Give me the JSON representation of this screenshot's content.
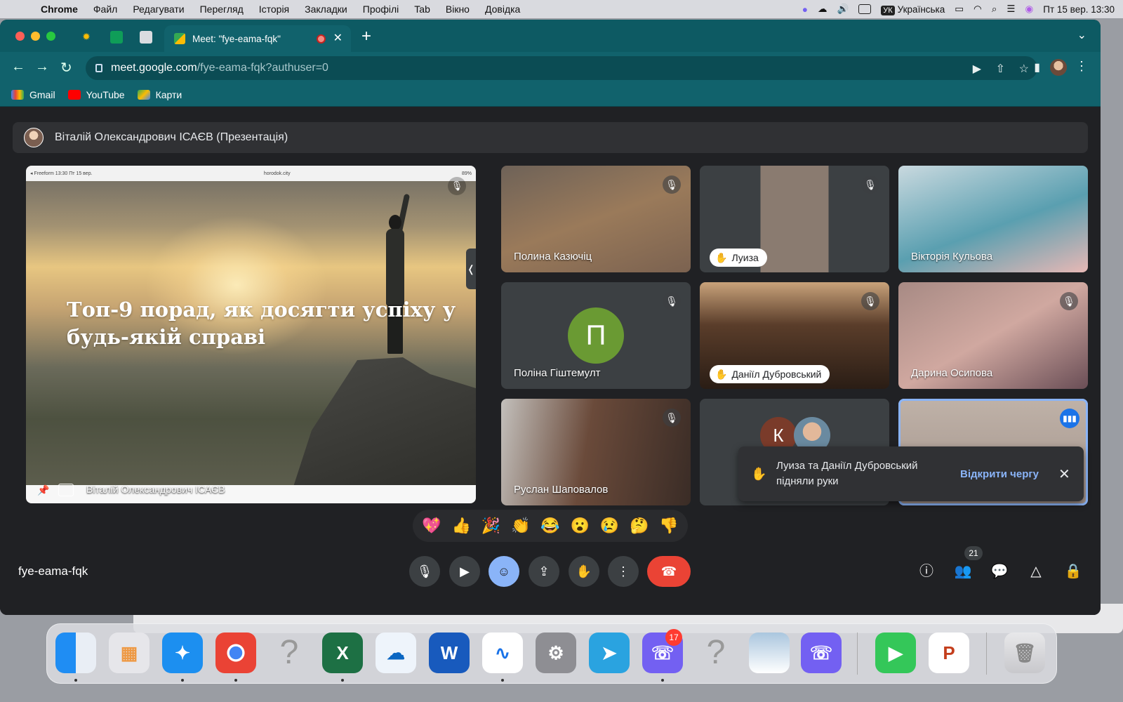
{
  "menubar": {
    "app": "Chrome",
    "menus": [
      "Файл",
      "Редагувати",
      "Перегляд",
      "Історія",
      "Закладки",
      "Профілі",
      "Tab",
      "Вікно",
      "Довідка"
    ],
    "keyboard_badge": "УК",
    "keyboard_layout": "Українська",
    "datetime": "Пт 15 вер. 13:30"
  },
  "browser": {
    "active_tab_title": "Meet: \"fye-eama-fqk\"",
    "url_host": "meet.google.com",
    "url_path": "/fye-eama-fqk?authuser=0",
    "bookmarks": [
      "Gmail",
      "YouTube",
      "Карти"
    ]
  },
  "meet": {
    "presenter_bar": "Віталій Олександрович ІСАЄВ (Презентація)",
    "presentation": {
      "slide_title": "Топ-9 порад, як досягти успіху у будь-якій справі",
      "device_status_left": "◂ Freeform 13:30 Пт 15 вер.",
      "device_url": "horodok.city",
      "device_status_right": "89%",
      "presenter_name": "Віталій Олександрович ІСАЄВ"
    },
    "tiles": [
      {
        "name": "Полина Казючіц",
        "muted": true,
        "hand": false
      },
      {
        "name": "Луиза",
        "muted": true,
        "hand": true
      },
      {
        "name": "Вікторія Кульова",
        "muted": false,
        "hand": false
      },
      {
        "name": "Поліна Гіштемулт",
        "muted": true,
        "hand": false,
        "initial": "П"
      },
      {
        "name": "Даніїл Дубровський",
        "muted": true,
        "hand": true
      },
      {
        "name": "Дарина Осипова",
        "muted": true,
        "hand": false
      },
      {
        "name": "Руслан Шаповалов",
        "muted": true,
        "hand": false
      },
      {
        "name": "",
        "initial": "К"
      },
      {
        "name": "",
        "speaking": true
      }
    ],
    "toast": {
      "text": "Луиза та Даніїл Дубровський підняли руки",
      "action": "Відкрити чергу"
    },
    "reactions": [
      "💖",
      "👍",
      "🎉",
      "👏",
      "😂",
      "😮",
      "😢",
      "🤔",
      "👎"
    ],
    "meeting_code": "fye-eama-fqk",
    "participants_count": "21"
  },
  "dock": {
    "viber_badge": "17"
  },
  "colors": {
    "tab_bar": "#0d5a63",
    "meet_bg": "#202124",
    "end_call": "#ea4335",
    "accent": "#8ab4f8"
  }
}
